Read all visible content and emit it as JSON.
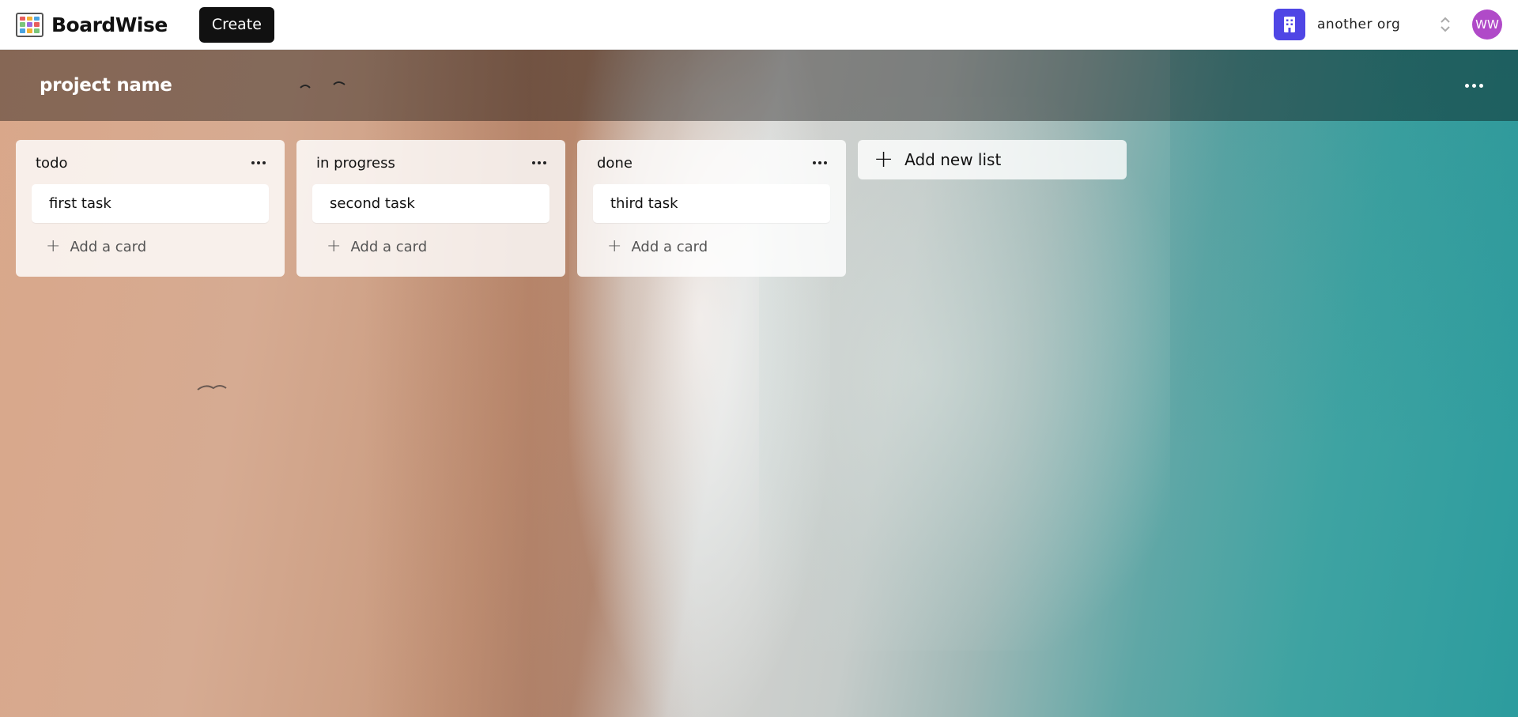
{
  "app": {
    "name": "BoardWise",
    "create_label": "Create",
    "org_name": "another org",
    "avatar_initials": "WW",
    "org_color": "#4f46e5",
    "avatar_color": "#b04ac8"
  },
  "board": {
    "title": "project name",
    "lists": [
      {
        "title": "todo",
        "cards": [
          "first task"
        ],
        "add_card_label": "Add a card"
      },
      {
        "title": "in progress",
        "cards": [
          "second task"
        ],
        "add_card_label": "Add a card"
      },
      {
        "title": "done",
        "cards": [
          "third task"
        ],
        "add_card_label": "Add a card"
      }
    ],
    "add_list_label": "Add new list"
  },
  "icons": {
    "logo": "boardwise-logo-icon",
    "org": "building-icon",
    "org_switch": "chevron-up-down-icon",
    "board_menu": "more-horizontal-icon",
    "list_menu": "more-horizontal-icon",
    "add": "plus-icon"
  }
}
